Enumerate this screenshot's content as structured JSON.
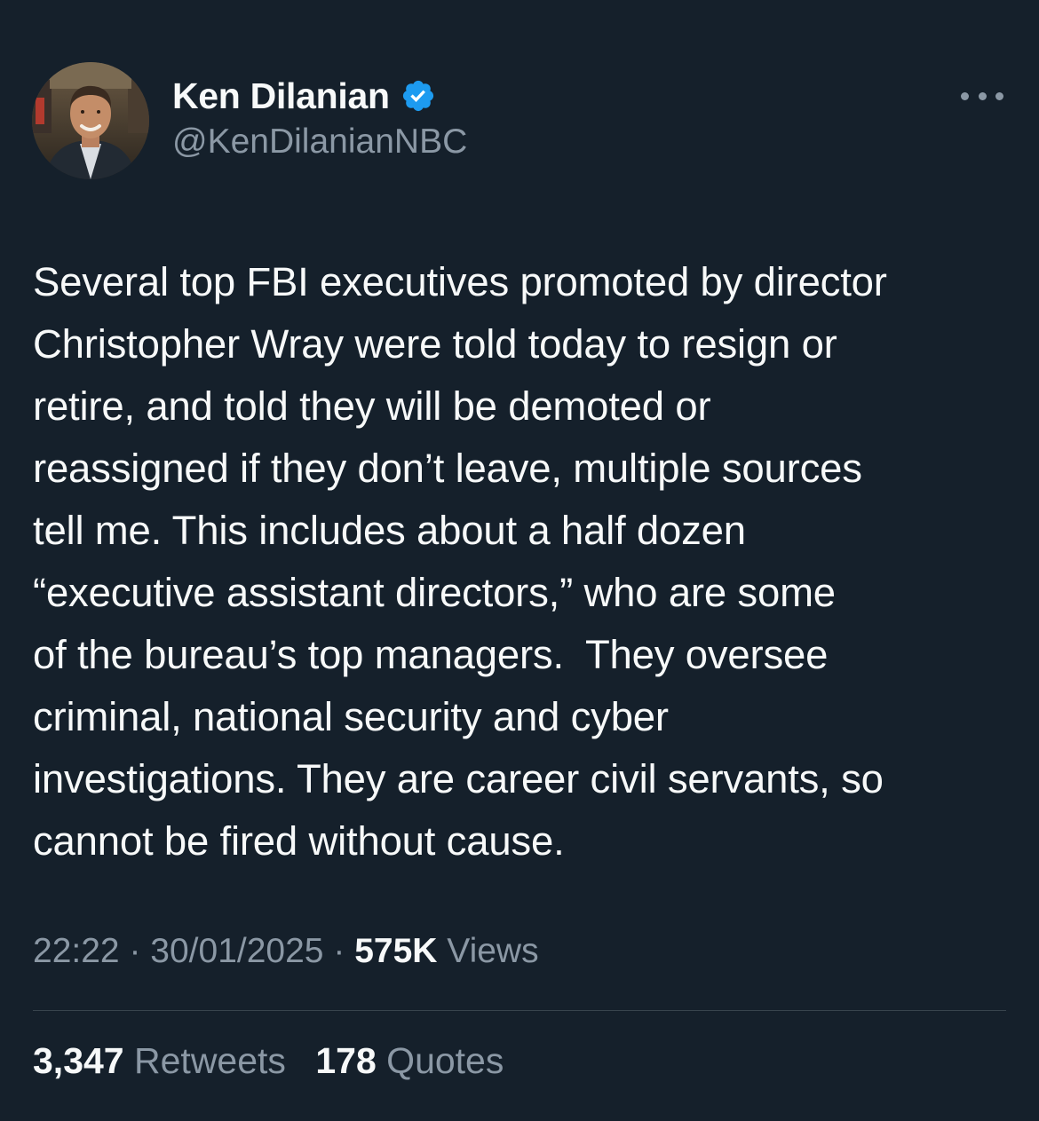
{
  "author": {
    "name": "Ken Dilanian",
    "handle": "@KenDilanianNBC",
    "verified": true,
    "avatar_icon": "profile-photo"
  },
  "more_icon": "more-horizontal-icon",
  "tweet": {
    "text": "Several top FBI executives promoted by director\nChristopher Wray were told today to resign or\nretire, and told they will be demoted or\nreassigned if they don’t leave, multiple sources\ntell me. This includes about a half dozen\n“executive assistant directors,” who are some\nof the bureau’s top managers.  They oversee\ncriminal, national security and cyber\ninvestigations. They are career civil servants, so\ncannot be fired without cause."
  },
  "meta": {
    "time": "22:22",
    "separator": "·",
    "date": "30/01/2025",
    "views_count": "575K",
    "views_label": "Views"
  },
  "stats": {
    "retweets_count": "3,347",
    "retweets_label": "Retweets",
    "quotes_count": "178",
    "quotes_label": "Quotes"
  },
  "colors": {
    "background": "#15202b",
    "text_primary": "#f7f9f9",
    "text_secondary": "#8b98a5",
    "verified_blue": "#1d9bf0",
    "divider": "#38444d"
  }
}
